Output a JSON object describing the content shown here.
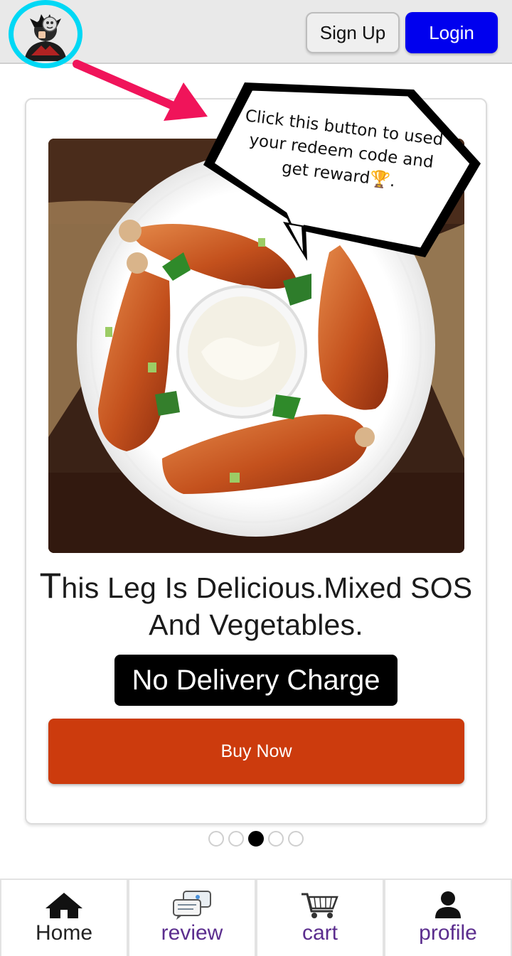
{
  "header": {
    "signup_label": "Sign Up",
    "login_label": "Login",
    "accent_color": "#00d8f5",
    "login_color": "#0000ee"
  },
  "product": {
    "title_first_letter": "T",
    "title_rest": "his Leg Is Delicious.Mixed SOS And Vegetables.",
    "badge": "No Delivery Charge",
    "buy_label": "Buy Now",
    "buy_color": "#cc3b0d"
  },
  "carousel": {
    "dot_count": 5,
    "active_index": 2
  },
  "tooltip": {
    "text": "Click this button to used your redeem code and get reward🏆."
  },
  "nav": {
    "items": [
      {
        "label": "Home",
        "icon": "home-icon"
      },
      {
        "label": "review",
        "icon": "chat-bubbles-icon"
      },
      {
        "label": "cart",
        "icon": "cart-icon"
      },
      {
        "label": "profile",
        "icon": "person-icon"
      }
    ]
  }
}
